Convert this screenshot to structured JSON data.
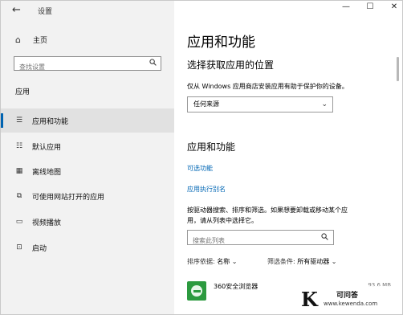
{
  "window": {
    "title": "设置",
    "back_icon": "back-arrow-icon",
    "controls": [
      "—",
      "☐",
      "✕"
    ]
  },
  "sidebar": {
    "home_label": "主页",
    "search_placeholder": "查找设置",
    "section_label": "应用",
    "items": [
      {
        "label": "应用和功能",
        "icon": "list-icon",
        "active": true
      },
      {
        "label": "默认应用",
        "icon": "default-apps-icon",
        "active": false
      },
      {
        "label": "离线地图",
        "icon": "map-icon",
        "active": false
      },
      {
        "label": "可使用网站打开的应用",
        "icon": "open-with-icon",
        "active": false
      },
      {
        "label": "视频播放",
        "icon": "video-icon",
        "active": false
      },
      {
        "label": "启动",
        "icon": "startup-icon",
        "active": false
      }
    ]
  },
  "main": {
    "title": "应用和功能",
    "choose_heading": "选择获取应用的位置",
    "choose_desc": "仅从 Windows 应用商店安装应用有助于保护你的设备。",
    "source_dropdown": "任何来源",
    "apps_heading": "应用和功能",
    "optional_features_link": "可选功能",
    "app_aliases_link": "应用执行别名",
    "search_desc_line1": "按驱动器搜索、排序和筛选。如果想要卸载或移动某个应",
    "search_desc_line2": "用，请从列表中选择它。",
    "search_placeholder": "搜索此列表",
    "sort_label": "排序依据:",
    "sort_value": "名称",
    "filter_label": "筛选条件:",
    "filter_value": "所有驱动器",
    "apps": [
      {
        "name": "360安全浏览器",
        "size": "93.6 MB"
      }
    ]
  },
  "watermark": {
    "logo": "K",
    "text": "可问答",
    "url": "www.kewenda.com"
  }
}
